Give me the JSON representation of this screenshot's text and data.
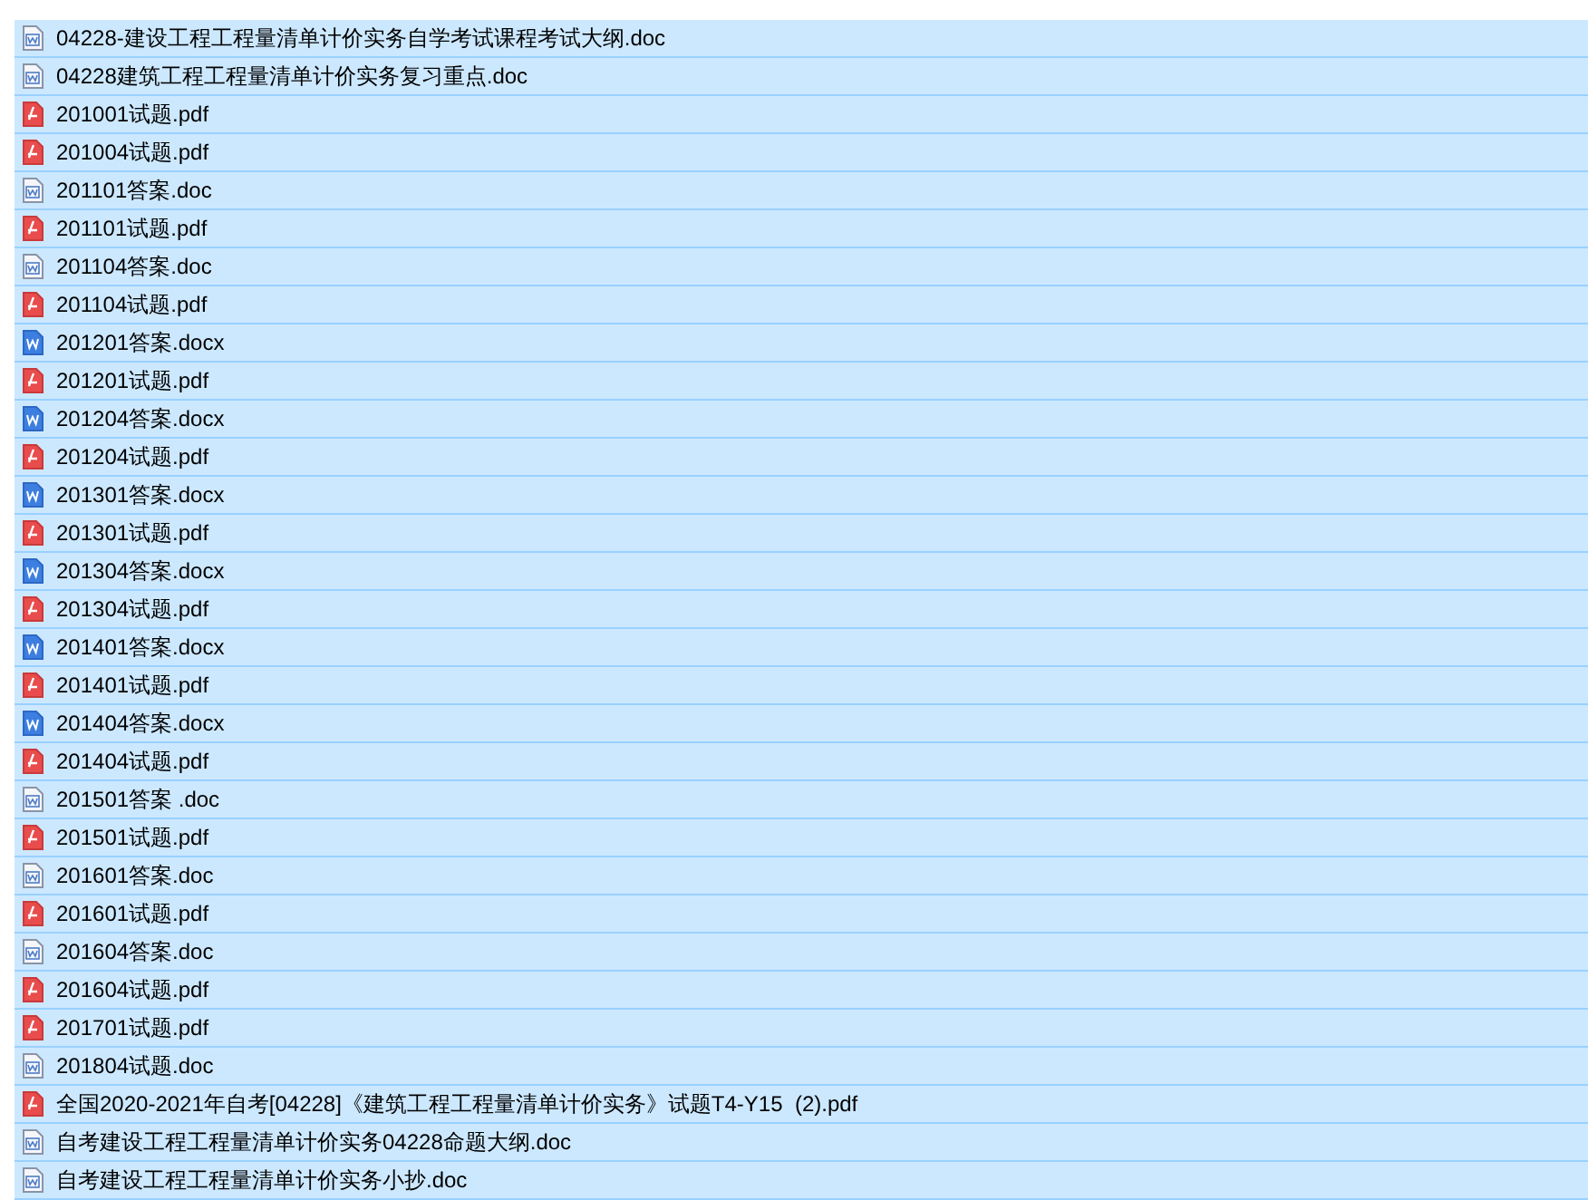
{
  "files": [
    {
      "name": "04228-建设工程工程量清单计价实务自学考试课程考试大纲.doc",
      "kind": "doc",
      "selected": true
    },
    {
      "name": "04228建筑工程工程量清单计价实务复习重点.doc",
      "kind": "doc",
      "selected": true
    },
    {
      "name": "201001试题.pdf",
      "kind": "pdf",
      "selected": true
    },
    {
      "name": "201004试题.pdf",
      "kind": "pdf",
      "selected": true
    },
    {
      "name": "201101答案.doc",
      "kind": "doc",
      "selected": true
    },
    {
      "name": "201101试题.pdf",
      "kind": "pdf",
      "selected": true
    },
    {
      "name": "201104答案.doc",
      "kind": "doc",
      "selected": true
    },
    {
      "name": "201104试题.pdf",
      "kind": "pdf",
      "selected": true
    },
    {
      "name": "201201答案.docx",
      "kind": "docx",
      "selected": true
    },
    {
      "name": "201201试题.pdf",
      "kind": "pdf",
      "selected": true
    },
    {
      "name": "201204答案.docx",
      "kind": "docx",
      "selected": true
    },
    {
      "name": "201204试题.pdf",
      "kind": "pdf",
      "selected": true
    },
    {
      "name": "201301答案.docx",
      "kind": "docx",
      "selected": true
    },
    {
      "name": "201301试题.pdf",
      "kind": "pdf",
      "selected": true
    },
    {
      "name": "201304答案.docx",
      "kind": "docx",
      "selected": true
    },
    {
      "name": "201304试题.pdf",
      "kind": "pdf",
      "selected": true
    },
    {
      "name": "201401答案.docx",
      "kind": "docx",
      "selected": true
    },
    {
      "name": "201401试题.pdf",
      "kind": "pdf",
      "selected": true
    },
    {
      "name": "201404答案.docx",
      "kind": "docx",
      "selected": true
    },
    {
      "name": "201404试题.pdf",
      "kind": "pdf",
      "selected": true
    },
    {
      "name": "201501答案 .doc",
      "kind": "doc",
      "selected": true
    },
    {
      "name": "201501试题.pdf",
      "kind": "pdf",
      "selected": true
    },
    {
      "name": "201601答案.doc",
      "kind": "doc",
      "selected": true
    },
    {
      "name": "201601试题.pdf",
      "kind": "pdf",
      "selected": true
    },
    {
      "name": "201604答案.doc",
      "kind": "doc",
      "selected": true
    },
    {
      "name": "201604试题.pdf",
      "kind": "pdf",
      "selected": true
    },
    {
      "name": "201701试题.pdf",
      "kind": "pdf",
      "selected": true
    },
    {
      "name": "201804试题.doc",
      "kind": "doc",
      "selected": true
    },
    {
      "name": "全国2020-2021年自考[04228]《建筑工程工程量清单计价实务》试题T4-Y15  (2).pdf",
      "kind": "pdf",
      "selected": true
    },
    {
      "name": "自考建设工程工程量清单计价实务04228命题大纲.doc",
      "kind": "doc",
      "selected": true
    },
    {
      "name": "自考建设工程工程量清单计价实务小抄.doc",
      "kind": "doc",
      "selected": true
    }
  ]
}
